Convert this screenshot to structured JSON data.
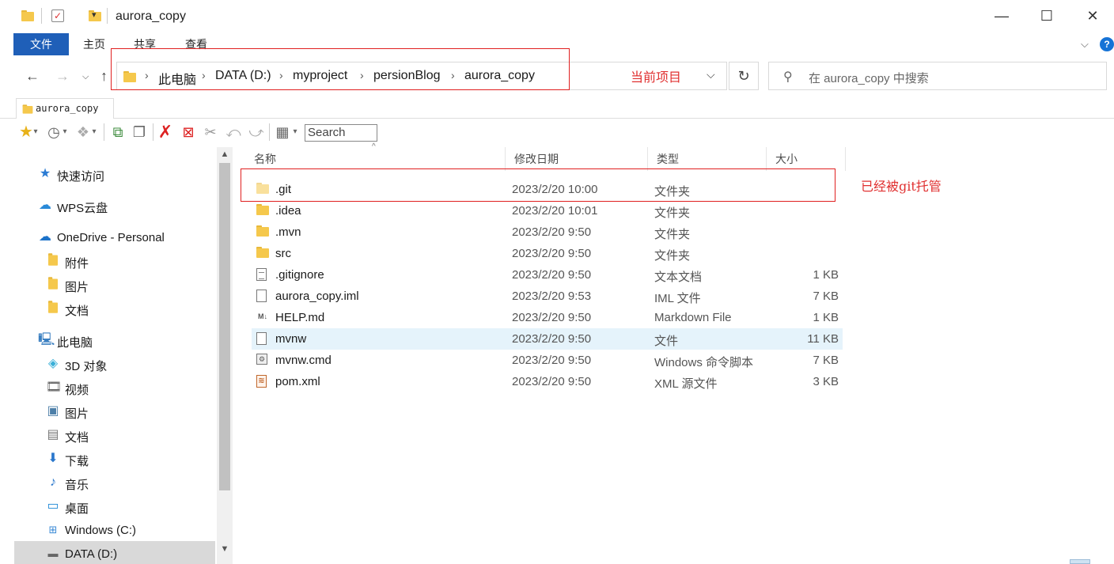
{
  "window": {
    "title": "aurora_copy",
    "buttons": {
      "minimize": "—",
      "maximize": "☐",
      "close": "✕"
    }
  },
  "ribbon": {
    "tabs": [
      "文件",
      "主页",
      "共享",
      "查看"
    ],
    "expand_icon": "chevron-down-icon",
    "help_label": "?"
  },
  "address": {
    "breadcrumbs": [
      "此电脑",
      "DATA (D:)",
      "myproject",
      "persionBlog",
      "aurora_copy"
    ],
    "search_placeholder": "在 aurora_copy 中搜索"
  },
  "annotations": {
    "current_project": "当前项目",
    "git_managed": "已经被git托管"
  },
  "tabstrip": {
    "tab_label": "aurora_copy"
  },
  "toolbar": {
    "search_placeholder": "Search"
  },
  "sidebar": {
    "items": [
      {
        "label": "快速访问",
        "icon": "star-icon"
      },
      {
        "label": "WPS云盘",
        "icon": "cloud-icon"
      },
      {
        "label": "OneDrive - Personal",
        "icon": "cloud-icon"
      },
      {
        "label": "附件",
        "icon": "folder-icon"
      },
      {
        "label": "图片",
        "icon": "folder-icon"
      },
      {
        "label": "文档",
        "icon": "folder-icon"
      },
      {
        "label": "此电脑",
        "icon": "computer-icon"
      },
      {
        "label": "3D 对象",
        "icon": "cube-icon"
      },
      {
        "label": "视频",
        "icon": "film-icon"
      },
      {
        "label": "图片",
        "icon": "picture-icon"
      },
      {
        "label": "文档",
        "icon": "document-icon"
      },
      {
        "label": "下载",
        "icon": "download-icon"
      },
      {
        "label": "音乐",
        "icon": "music-icon"
      },
      {
        "label": "桌面",
        "icon": "desktop-icon"
      },
      {
        "label": "Windows (C:)",
        "icon": "drive-icon"
      },
      {
        "label": "DATA (D:)",
        "icon": "drive-icon"
      }
    ]
  },
  "filelist": {
    "columns": [
      "名称",
      "修改日期",
      "类型",
      "大小"
    ],
    "rows": [
      {
        "name": ".git",
        "date": "2023/2/20 10:00",
        "type": "文件夹",
        "size": "",
        "icon": "folder-icon"
      },
      {
        "name": ".idea",
        "date": "2023/2/20 10:01",
        "type": "文件夹",
        "size": "",
        "icon": "folder-icon"
      },
      {
        "name": ".mvn",
        "date": "2023/2/20 9:50",
        "type": "文件夹",
        "size": "",
        "icon": "folder-icon"
      },
      {
        "name": "src",
        "date": "2023/2/20 9:50",
        "type": "文件夹",
        "size": "",
        "icon": "folder-icon"
      },
      {
        "name": ".gitignore",
        "date": "2023/2/20 9:50",
        "type": "文本文档",
        "size": "1 KB",
        "icon": "text-file-icon"
      },
      {
        "name": "aurora_copy.iml",
        "date": "2023/2/20 9:53",
        "type": "IML 文件",
        "size": "7 KB",
        "icon": "file-icon"
      },
      {
        "name": "HELP.md",
        "date": "2023/2/20 9:50",
        "type": "Markdown File",
        "size": "1 KB",
        "icon": "markdown-icon"
      },
      {
        "name": "mvnw",
        "date": "2023/2/20 9:50",
        "type": "文件",
        "size": "11 KB",
        "icon": "file-icon"
      },
      {
        "name": "mvnw.cmd",
        "date": "2023/2/20 9:50",
        "type": "Windows 命令脚本",
        "size": "7 KB",
        "icon": "cmd-icon"
      },
      {
        "name": "pom.xml",
        "date": "2023/2/20 9:50",
        "type": "XML 源文件",
        "size": "3 KB",
        "icon": "xml-icon"
      }
    ]
  }
}
